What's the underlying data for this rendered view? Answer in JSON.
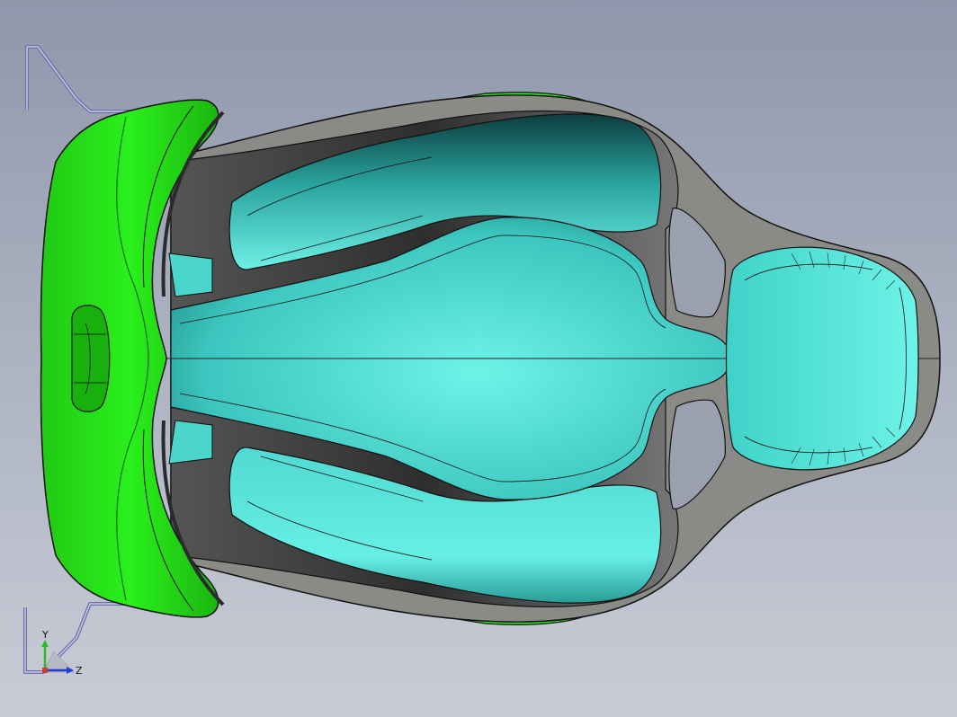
{
  "viewport": {
    "background_top": "#8e97ab",
    "background_bottom": "#c9ccd6"
  },
  "model": {
    "colors": {
      "seat_surface": "#5ee3d8",
      "seat_surface_dark": "#0e4c4c",
      "shell_green": "#22e014",
      "shell_green_dark": "#169c0c",
      "frame_gray": "#8a8a86",
      "frame_dark": "#3a3a3a",
      "outline": "#111111"
    }
  },
  "triad": {
    "y_label": "Y",
    "z_label": "Z",
    "y_color": "#2fb82f",
    "z_color": "#1e3fd8",
    "x_color": "#d43a2a"
  }
}
